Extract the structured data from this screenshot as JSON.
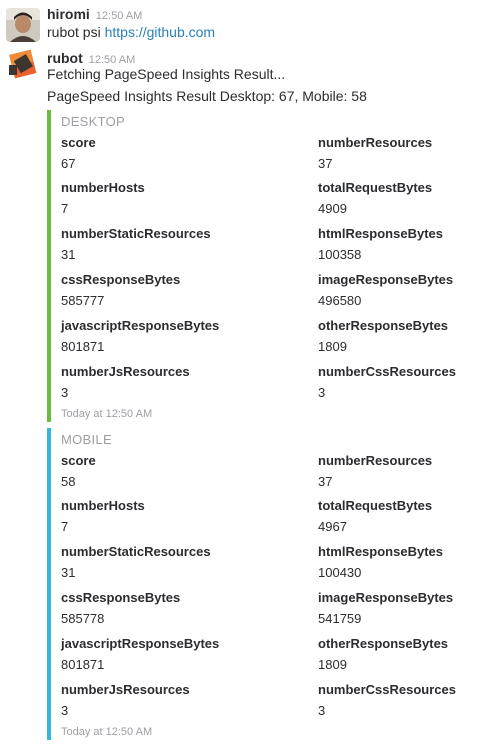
{
  "messages": [
    {
      "user": "hiromi",
      "time": "12:50 AM",
      "text": "rubot psi ",
      "link": "https://github.com"
    },
    {
      "user": "rubot",
      "time": "12:50 AM",
      "lines": [
        "Fetching PageSpeed Insights Result...",
        "PageSpeed Insights Result Desktop: 67, Mobile: 58"
      ]
    }
  ],
  "attachments": {
    "desktop": {
      "title": "DESKTOP",
      "color": "#6bbd3f",
      "footer": "Today at 12:50 AM",
      "fields": [
        {
          "label": "score",
          "value": "67"
        },
        {
          "label": "numberResources",
          "value": "37"
        },
        {
          "label": "numberHosts",
          "value": "7"
        },
        {
          "label": "totalRequestBytes",
          "value": "4909"
        },
        {
          "label": "numberStaticResources",
          "value": "31"
        },
        {
          "label": "htmlResponseBytes",
          "value": "100358"
        },
        {
          "label": "cssResponseBytes",
          "value": "585777"
        },
        {
          "label": "imageResponseBytes",
          "value": "496580"
        },
        {
          "label": "javascriptResponseBytes",
          "value": "801871"
        },
        {
          "label": "otherResponseBytes",
          "value": "1809"
        },
        {
          "label": "numberJsResources",
          "value": "3"
        },
        {
          "label": "numberCssResources",
          "value": "3"
        }
      ]
    },
    "mobile": {
      "title": "MOBILE",
      "color": "#36b5dd",
      "footer": "Today at 12:50 AM",
      "fields": [
        {
          "label": "score",
          "value": "58"
        },
        {
          "label": "numberResources",
          "value": "37"
        },
        {
          "label": "numberHosts",
          "value": "7"
        },
        {
          "label": "totalRequestBytes",
          "value": "4967"
        },
        {
          "label": "numberStaticResources",
          "value": "31"
        },
        {
          "label": "htmlResponseBytes",
          "value": "100430"
        },
        {
          "label": "cssResponseBytes",
          "value": "585778"
        },
        {
          "label": "imageResponseBytes",
          "value": "541759"
        },
        {
          "label": "javascriptResponseBytes",
          "value": "801871"
        },
        {
          "label": "otherResponseBytes",
          "value": "1809"
        },
        {
          "label": "numberJsResources",
          "value": "3"
        },
        {
          "label": "numberCssResources",
          "value": "3"
        }
      ]
    }
  }
}
